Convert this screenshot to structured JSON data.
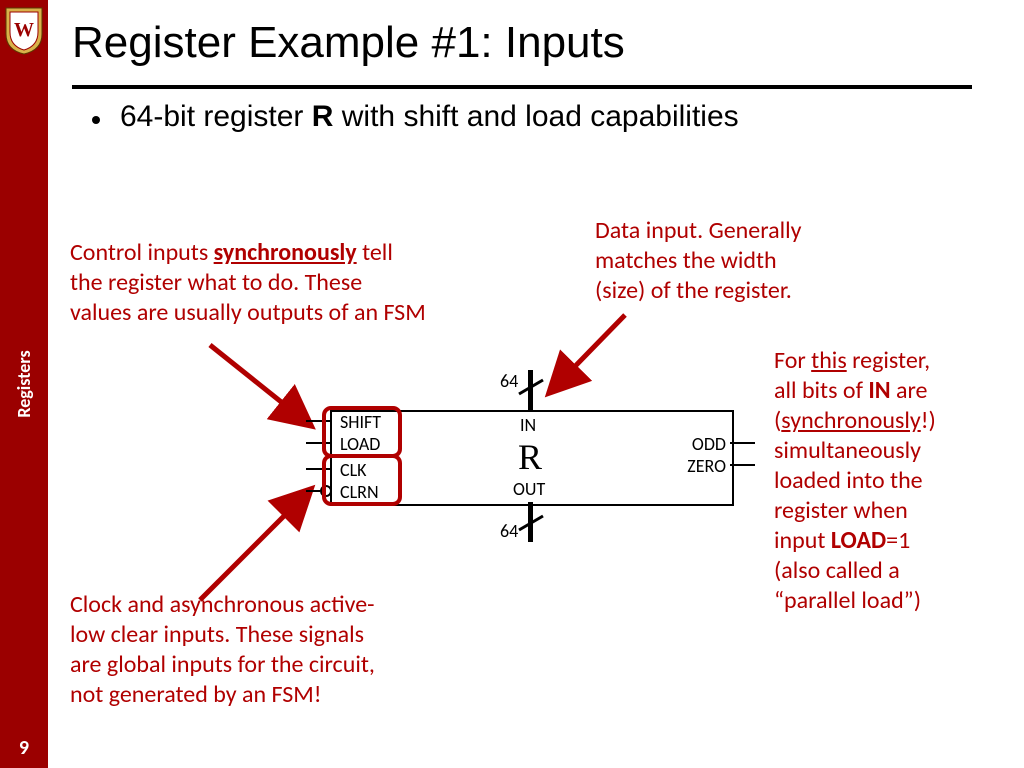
{
  "sidebar": {
    "label": "Registers",
    "page": "9"
  },
  "title": "Register Example #1: Inputs",
  "bullet": {
    "pre": "64-bit register ",
    "reg": "R",
    "post": " with shift and load capabilities"
  },
  "anno": {
    "control": {
      "pre": "Control inputs ",
      "sync": "synchronously",
      "post1": " tell",
      "l2": "the register what to do. These",
      "l3": "values are usually outputs of an FSM"
    },
    "clock": {
      "l1": "Clock and asynchronous active-",
      "l2": "low clear inputs. These signals",
      "l3": "are global inputs for the circuit,",
      "l4": "not generated by an FSM!"
    },
    "data": {
      "l1": "Data input. Generally",
      "l2": "matches the width",
      "l3": "(size) of the register."
    },
    "load": {
      "pre": "For ",
      "this": "this",
      "post1": " register,",
      "l2a": "all bits of ",
      "in": "IN",
      "l2b": " are",
      "l3a": "(",
      "sync": "synchronously",
      "l3b": "!)",
      "l4": "simultaneously",
      "l5": "loaded into the",
      "l6": "register when",
      "l7a": "input ",
      "load": "LOAD",
      "l7b": "=1",
      "l8": "(also called a",
      "l9": "“parallel load”)"
    }
  },
  "diagram": {
    "name": "R",
    "width_top": "64",
    "width_bot": "64",
    "in": "IN",
    "out": "OUT",
    "left": {
      "shift": "SHIFT",
      "load": "LOAD",
      "clk": "CLK",
      "clrn": "CLRN"
    },
    "right": {
      "odd": "ODD",
      "zero": "ZERO"
    }
  }
}
